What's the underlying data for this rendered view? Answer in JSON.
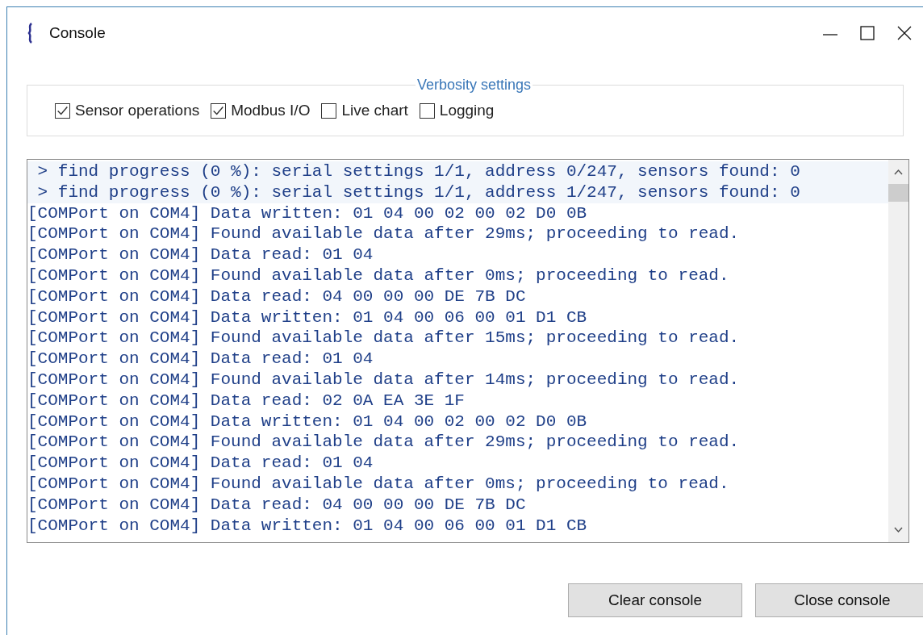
{
  "window": {
    "title": "Console"
  },
  "verbosity": {
    "title": "Verbosity settings",
    "options": [
      {
        "label": "Sensor operations",
        "checked": true
      },
      {
        "label": "Modbus I/O",
        "checked": true
      },
      {
        "label": "Live chart",
        "checked": false
      },
      {
        "label": "Logging",
        "checked": false
      }
    ]
  },
  "console": {
    "lines": [
      {
        "text": " > find progress (0 %): serial settings 1/1, address 0/247, sensors found: 0",
        "selected": true
      },
      {
        "text": " > find progress (0 %): serial settings 1/1, address 1/247, sensors found: 0",
        "selected": true
      },
      {
        "text": "[COMPort on COM4] Data written: 01 04 00 02 00 02 D0 0B",
        "selected": false
      },
      {
        "text": "[COMPort on COM4] Found available data after 29ms; proceeding to read.",
        "selected": false
      },
      {
        "text": "[COMPort on COM4] Data read: 01 04",
        "selected": false
      },
      {
        "text": "[COMPort on COM4] Found available data after 0ms; proceeding to read.",
        "selected": false
      },
      {
        "text": "[COMPort on COM4] Data read: 04 00 00 00 DE 7B DC",
        "selected": false
      },
      {
        "text": "[COMPort on COM4] Data written: 01 04 00 06 00 01 D1 CB",
        "selected": false
      },
      {
        "text": "[COMPort on COM4] Found available data after 15ms; proceeding to read.",
        "selected": false
      },
      {
        "text": "[COMPort on COM4] Data read: 01 04",
        "selected": false
      },
      {
        "text": "[COMPort on COM4] Found available data after 14ms; proceeding to read.",
        "selected": false
      },
      {
        "text": "[COMPort on COM4] Data read: 02 0A EA 3E 1F",
        "selected": false
      },
      {
        "text": "[COMPort on COM4] Data written: 01 04 00 02 00 02 D0 0B",
        "selected": false
      },
      {
        "text": "[COMPort on COM4] Found available data after 29ms; proceeding to read.",
        "selected": false
      },
      {
        "text": "[COMPort on COM4] Data read: 01 04",
        "selected": false
      },
      {
        "text": "[COMPort on COM4] Found available data after 0ms; proceeding to read.",
        "selected": false
      },
      {
        "text": "[COMPort on COM4] Data read: 04 00 00 00 DE 7B DC",
        "selected": false
      },
      {
        "text": "[COMPort on COM4] Data written: 01 04 00 06 00 01 D1 CB",
        "selected": false
      }
    ]
  },
  "buttons": [
    "Clear console",
    "Close console"
  ]
}
